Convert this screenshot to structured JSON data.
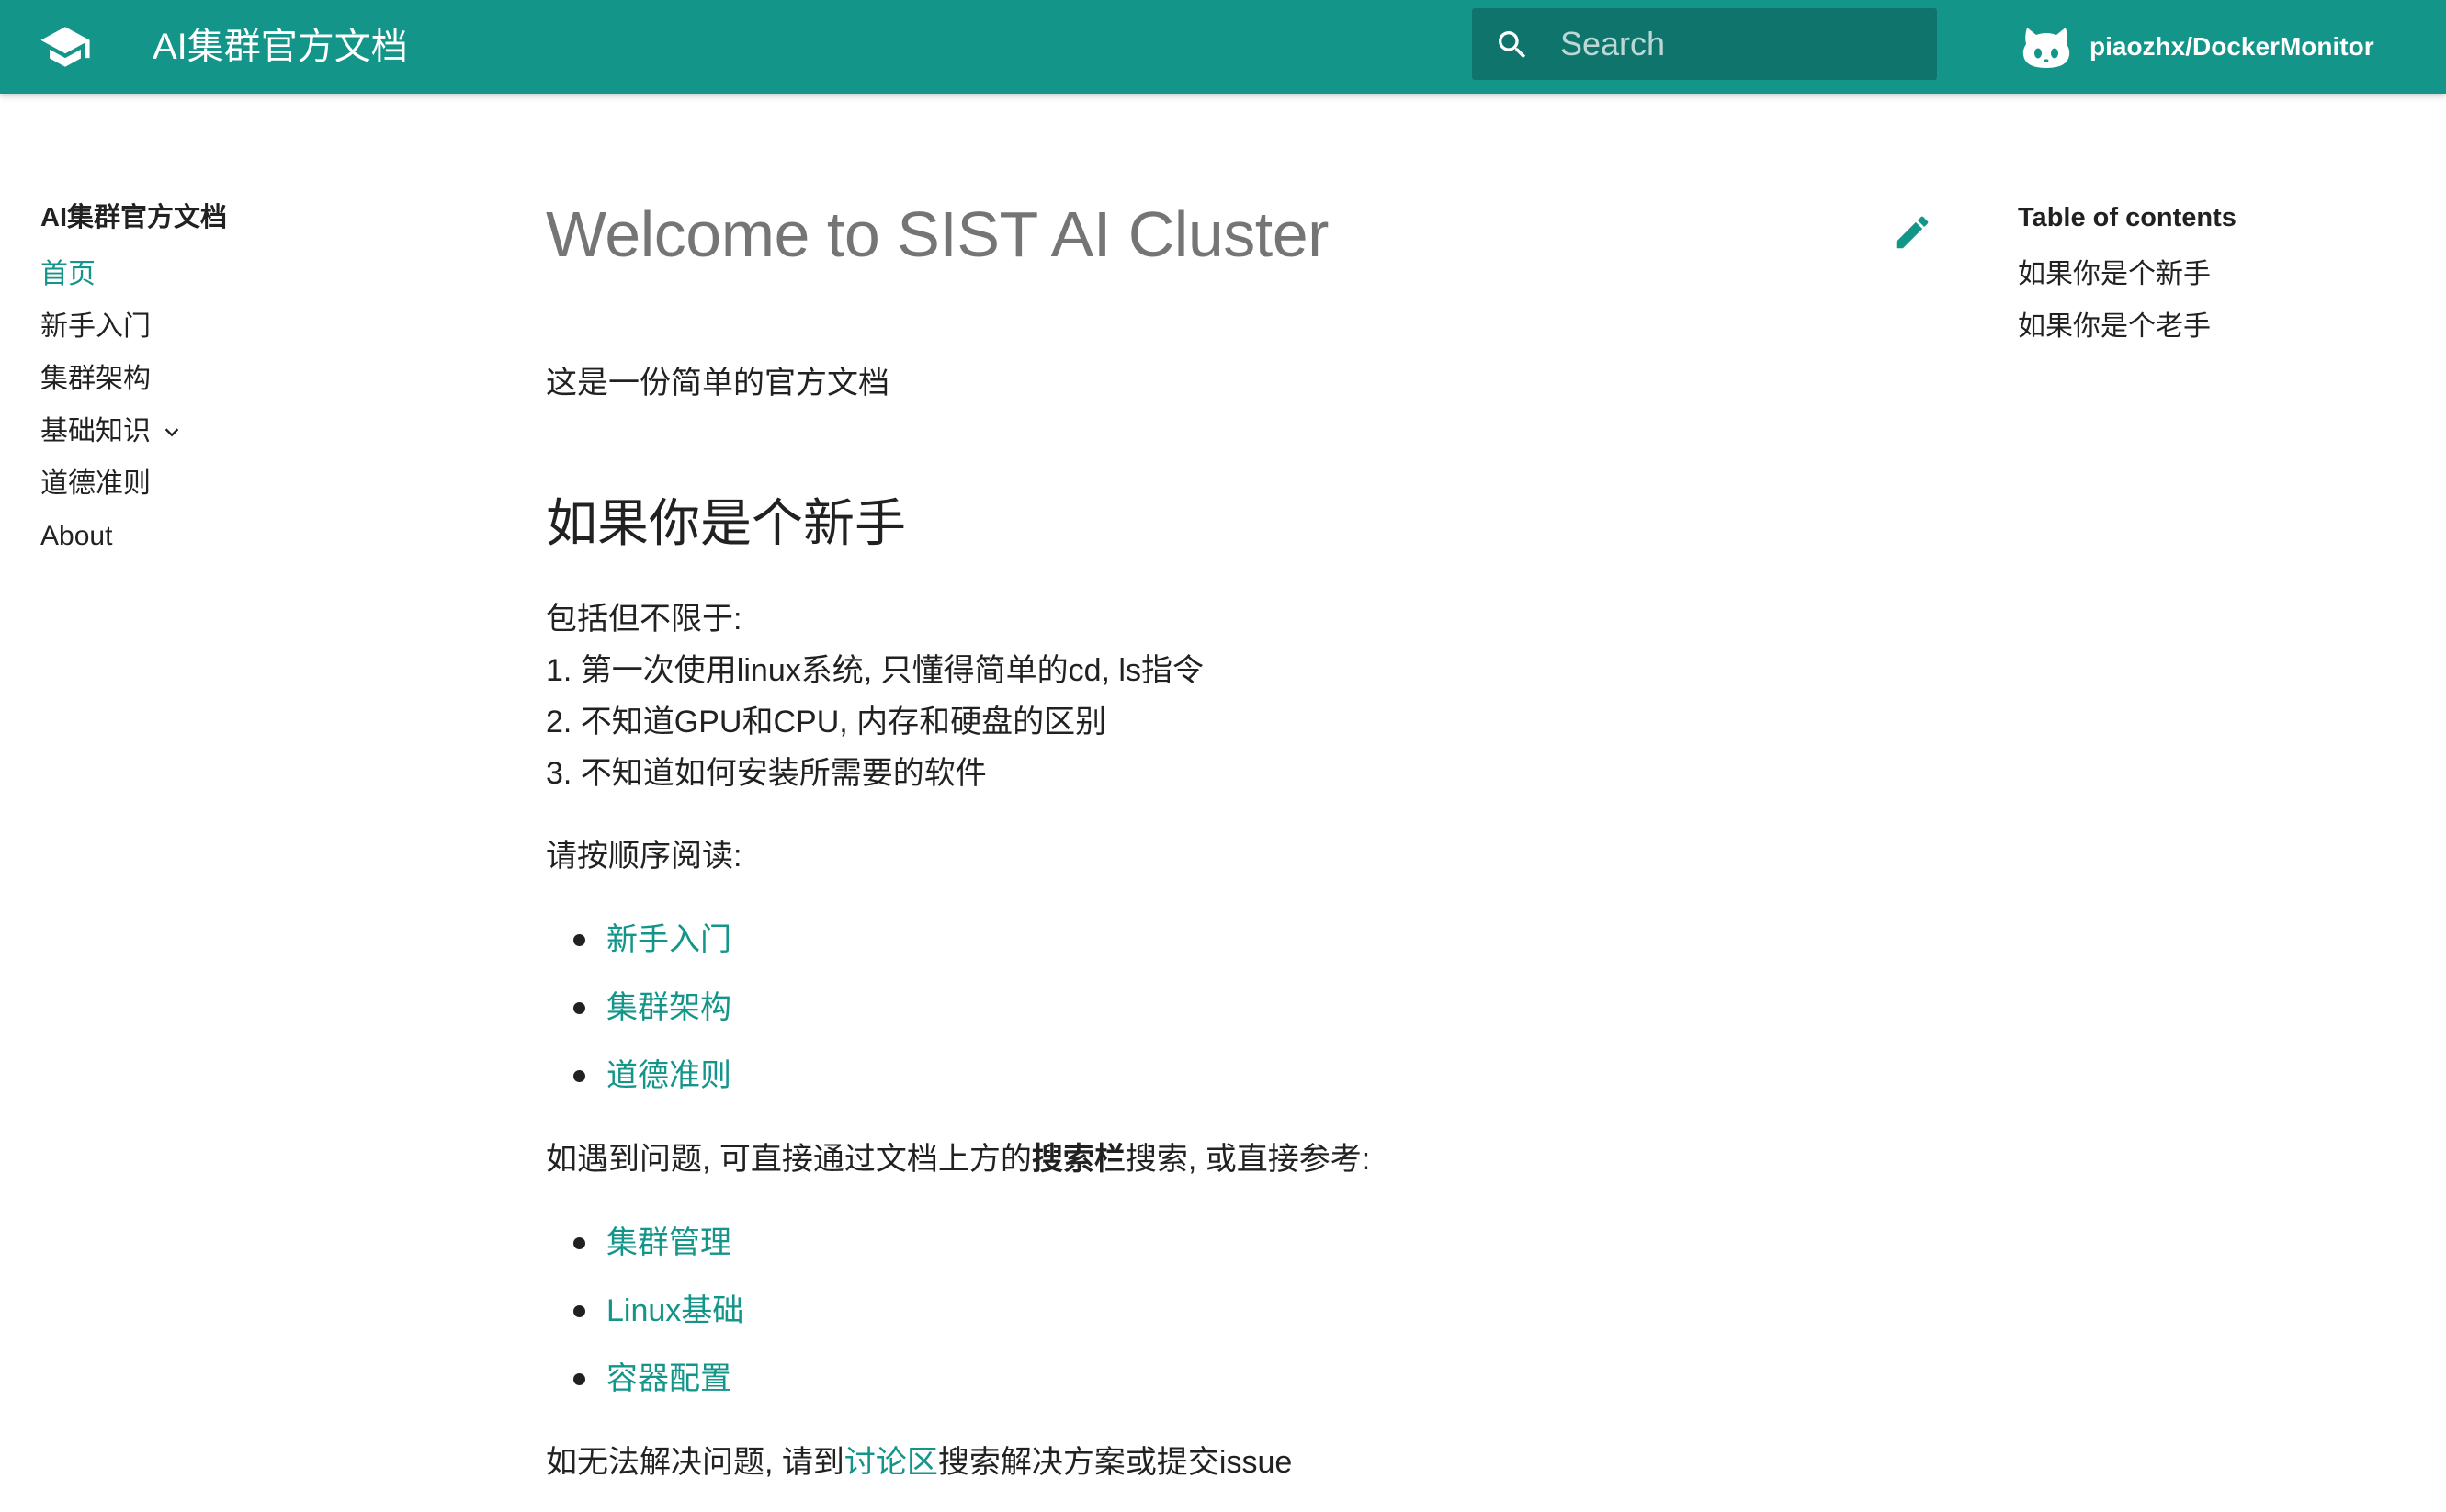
{
  "header": {
    "logo_icon": "graduation-cap-icon",
    "site_title": "AI集群官方文档",
    "search_placeholder": "Search",
    "search_value": "",
    "repo_icon": "github-cat-icon",
    "repo_name": "piaozhx/DockerMonitor",
    "color": "#14958a"
  },
  "sidebar": {
    "title": "AI集群官方文档",
    "items": [
      {
        "label": "首页",
        "active": true
      },
      {
        "label": "新手入门",
        "active": false
      },
      {
        "label": "集群架构",
        "active": false
      },
      {
        "label": "基础知识",
        "active": false,
        "expandable": true
      },
      {
        "label": "道德准则",
        "active": false
      },
      {
        "label": "About",
        "active": false
      }
    ]
  },
  "main": {
    "title": "Welcome to SIST AI Cluster",
    "edit_icon": "pencil-icon",
    "intro": "这是一份简单的官方文档",
    "section_title": "如果你是个新手",
    "para1": {
      "line1": "包括但不限于:",
      "line2": "1. 第一次使用linux系统, 只懂得简单的cd, ls指令",
      "line3": "2. 不知道GPU和CPU, 内存和硬盘的区别",
      "line4": "3. 不知道如何安装所需要的软件"
    },
    "read_order": "请按顺序阅读:",
    "read_links": [
      "新手入门",
      "集群架构",
      "道德准则"
    ],
    "problem": {
      "before": "如遇到问题, 可直接通过文档上方的",
      "bold": "搜索栏",
      "after": "搜索, 或直接参考:"
    },
    "ref_links": [
      "集群管理",
      "Linux基础",
      "容器配置"
    ],
    "last": {
      "before": "如无法解决问题, 请到",
      "link": "讨论区",
      "after": "搜索解决方案或提交issue"
    }
  },
  "toc": {
    "title": "Table of contents",
    "items": [
      "如果你是个新手",
      "如果你是个老手"
    ]
  }
}
